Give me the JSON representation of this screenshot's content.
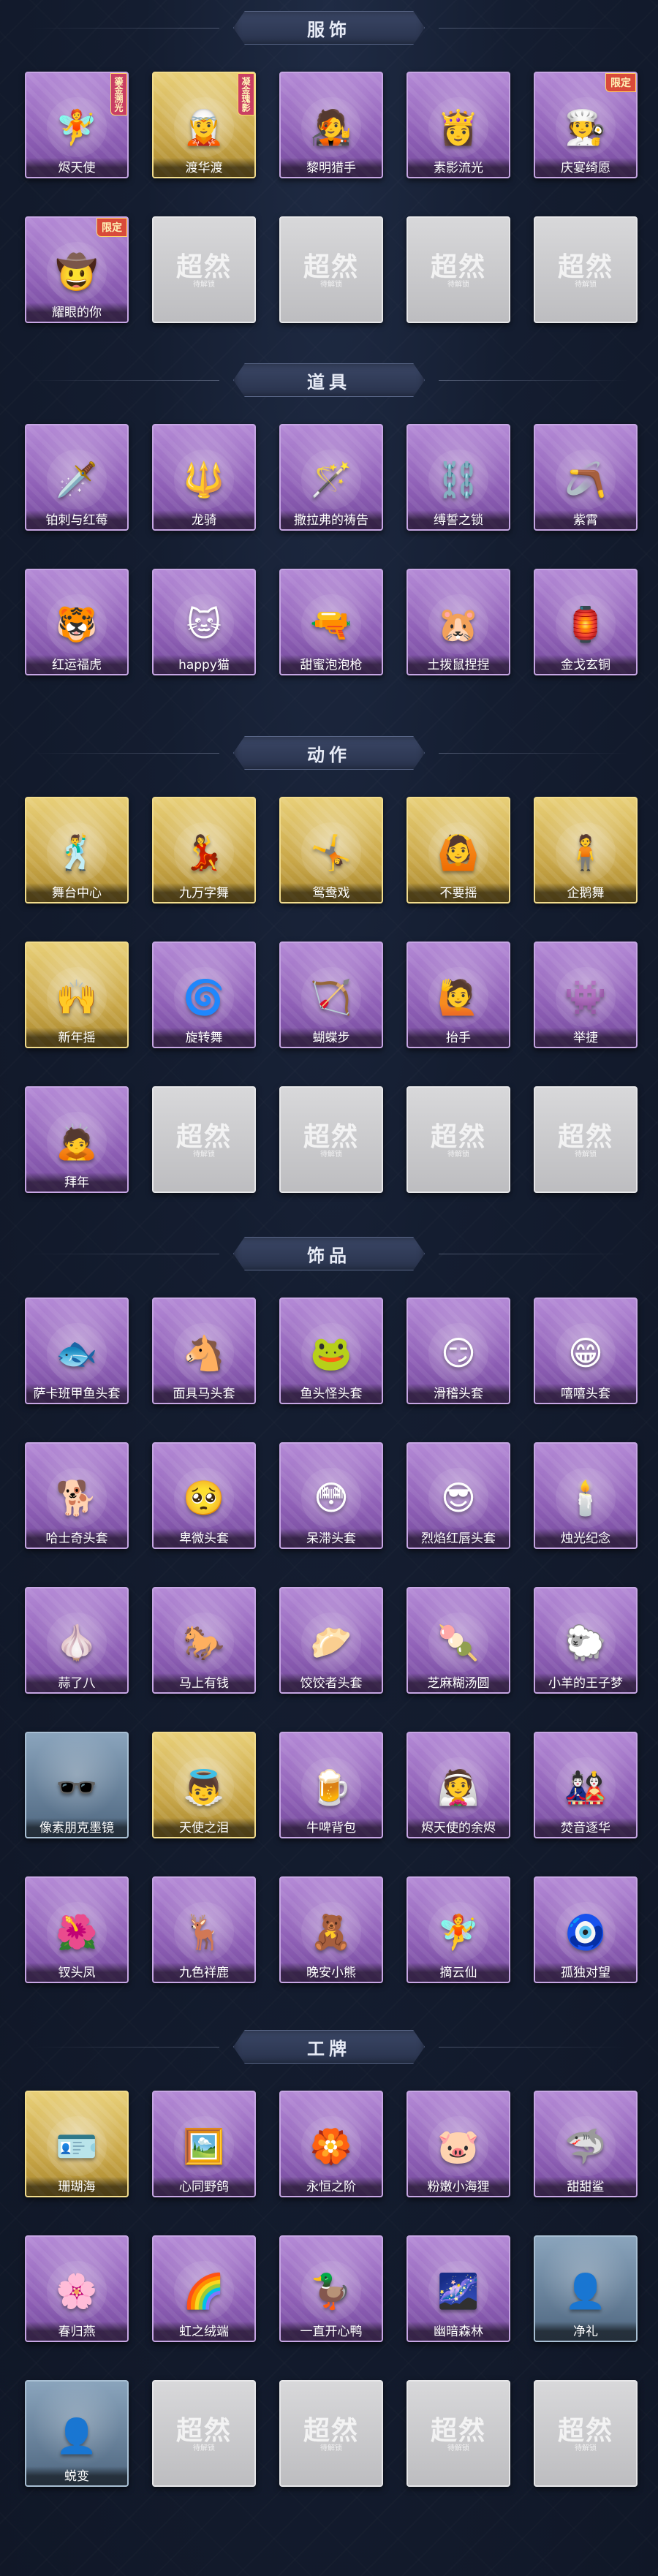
{
  "sections": [
    {
      "title": "服饰",
      "items": [
        {
          "name": "烬天使",
          "rarity": "purple",
          "icon": "🧚",
          "badge": "鎏金溯光"
        },
        {
          "name": "渡华渡",
          "rarity": "gold",
          "icon": "🧝",
          "badge": "凝金瑰影"
        },
        {
          "name": "黎明猎手",
          "rarity": "purple",
          "icon": "🧑‍🎤",
          "badge": ""
        },
        {
          "name": "素影流光",
          "rarity": "purple",
          "icon": "👸",
          "badge": ""
        },
        {
          "name": "庆宴绮愿",
          "rarity": "purple",
          "icon": "🧑‍🍳",
          "badge": "限定"
        },
        {
          "name": "耀眼的你",
          "rarity": "purple",
          "icon": "🤠",
          "badge": "限定"
        },
        {
          "name": "",
          "rarity": "grey",
          "icon": "",
          "badge": ""
        },
        {
          "name": "",
          "rarity": "grey",
          "icon": "",
          "badge": ""
        },
        {
          "name": "",
          "rarity": "grey",
          "icon": "",
          "badge": ""
        },
        {
          "name": "",
          "rarity": "grey",
          "icon": "",
          "badge": ""
        }
      ]
    },
    {
      "title": "道具",
      "items": [
        {
          "name": "铂刺与红莓",
          "rarity": "purple",
          "icon": "🗡️",
          "badge": ""
        },
        {
          "name": "龙骑",
          "rarity": "purple",
          "icon": "🔱",
          "badge": ""
        },
        {
          "name": "撒拉弗的祷告",
          "rarity": "purple",
          "icon": "🪄",
          "badge": ""
        },
        {
          "name": "缚誓之锁",
          "rarity": "purple",
          "icon": "⛓️",
          "badge": ""
        },
        {
          "name": "紫霄",
          "rarity": "purple",
          "icon": "🪃",
          "badge": ""
        },
        {
          "name": "红运福虎",
          "rarity": "purple",
          "icon": "🐯",
          "badge": ""
        },
        {
          "name": "happy猫",
          "rarity": "purple",
          "icon": "🐱",
          "badge": ""
        },
        {
          "name": "甜蜜泡泡枪",
          "rarity": "purple",
          "icon": "🔫",
          "badge": ""
        },
        {
          "name": "土拨鼠捏捏",
          "rarity": "purple",
          "icon": "🐹",
          "badge": ""
        },
        {
          "name": "金戈玄铜",
          "rarity": "purple",
          "icon": "🏮",
          "badge": ""
        }
      ]
    },
    {
      "title": "动作",
      "items": [
        {
          "name": "舞台中心",
          "rarity": "gold",
          "icon": "🕺",
          "badge": ""
        },
        {
          "name": "九万字舞",
          "rarity": "gold",
          "icon": "💃",
          "badge": ""
        },
        {
          "name": "鸳鸯戏",
          "rarity": "gold",
          "icon": "🤸",
          "badge": ""
        },
        {
          "name": "不要摇",
          "rarity": "gold",
          "icon": "🙆",
          "badge": ""
        },
        {
          "name": "企鹅舞",
          "rarity": "gold",
          "icon": "🧍",
          "badge": ""
        },
        {
          "name": "新年摇",
          "rarity": "gold",
          "icon": "🙌",
          "badge": ""
        },
        {
          "name": "旋转舞",
          "rarity": "purple",
          "icon": "🌀",
          "badge": ""
        },
        {
          "name": "蝴蝶步",
          "rarity": "purple",
          "icon": "🏹",
          "badge": ""
        },
        {
          "name": "抬手",
          "rarity": "purple",
          "icon": "🙋",
          "badge": ""
        },
        {
          "name": "举捷",
          "rarity": "purple",
          "icon": "👾",
          "badge": ""
        },
        {
          "name": "拜年",
          "rarity": "purple",
          "icon": "🙇",
          "badge": ""
        },
        {
          "name": "",
          "rarity": "grey",
          "icon": "",
          "badge": ""
        },
        {
          "name": "",
          "rarity": "grey",
          "icon": "",
          "badge": ""
        },
        {
          "name": "",
          "rarity": "grey",
          "icon": "",
          "badge": ""
        },
        {
          "name": "",
          "rarity": "grey",
          "icon": "",
          "badge": ""
        }
      ]
    },
    {
      "title": "饰品",
      "items": [
        {
          "name": "萨卡班甲鱼头套",
          "rarity": "purple",
          "icon": "🐟",
          "badge": ""
        },
        {
          "name": "面具马头套",
          "rarity": "purple",
          "icon": "🐴",
          "badge": ""
        },
        {
          "name": "鱼头怪头套",
          "rarity": "purple",
          "icon": "🐸",
          "badge": ""
        },
        {
          "name": "滑稽头套",
          "rarity": "purple",
          "icon": "😏",
          "badge": ""
        },
        {
          "name": "嘻嘻头套",
          "rarity": "purple",
          "icon": "😁",
          "badge": ""
        },
        {
          "name": "哈士奇头套",
          "rarity": "purple",
          "icon": "🐕",
          "badge": ""
        },
        {
          "name": "卑微头套",
          "rarity": "purple",
          "icon": "🥺",
          "badge": ""
        },
        {
          "name": "呆滞头套",
          "rarity": "purple",
          "icon": "😳",
          "badge": ""
        },
        {
          "name": "烈焰红唇头套",
          "rarity": "purple",
          "icon": "😎",
          "badge": ""
        },
        {
          "name": "烛光纪念",
          "rarity": "purple",
          "icon": "🕯️",
          "badge": ""
        },
        {
          "name": "蒜了八",
          "rarity": "purple",
          "icon": "🧄",
          "badge": ""
        },
        {
          "name": "马上有钱",
          "rarity": "purple",
          "icon": "🐎",
          "badge": ""
        },
        {
          "name": "饺饺者头套",
          "rarity": "purple",
          "icon": "🥟",
          "badge": ""
        },
        {
          "name": "芝麻糊汤圆",
          "rarity": "purple",
          "icon": "🍡",
          "badge": ""
        },
        {
          "name": "小羊的王子梦",
          "rarity": "purple",
          "icon": "🐑",
          "badge": ""
        },
        {
          "name": "像素朋克墨镜",
          "rarity": "blue",
          "icon": "🕶️",
          "badge": ""
        },
        {
          "name": "天使之泪",
          "rarity": "gold",
          "icon": "👼",
          "badge": ""
        },
        {
          "name": "牛啤背包",
          "rarity": "purple",
          "icon": "🍺",
          "badge": ""
        },
        {
          "name": "烬天使的余烬",
          "rarity": "purple",
          "icon": "👰",
          "badge": ""
        },
        {
          "name": "焚音逐华",
          "rarity": "purple",
          "icon": "🎎",
          "badge": ""
        },
        {
          "name": "钗头凤",
          "rarity": "purple",
          "icon": "🌺",
          "badge": ""
        },
        {
          "name": "九色祥鹿",
          "rarity": "purple",
          "icon": "🦌",
          "badge": ""
        },
        {
          "name": "晚安小熊",
          "rarity": "purple",
          "icon": "🧸",
          "badge": ""
        },
        {
          "name": "摘云仙",
          "rarity": "purple",
          "icon": "🧚",
          "badge": ""
        },
        {
          "name": "孤独对望",
          "rarity": "purple",
          "icon": "🧿",
          "badge": ""
        }
      ]
    },
    {
      "title": "工牌",
      "items": [
        {
          "name": "珊瑚海",
          "rarity": "gold",
          "icon": "🪪",
          "badge": ""
        },
        {
          "name": "心同野鸽",
          "rarity": "purple",
          "icon": "🖼️",
          "badge": ""
        },
        {
          "name": "永恒之阶",
          "rarity": "purple",
          "icon": "🏵️",
          "badge": ""
        },
        {
          "name": "粉嫩小海狸",
          "rarity": "purple",
          "icon": "🐷",
          "badge": ""
        },
        {
          "name": "甜甜鲨",
          "rarity": "purple",
          "icon": "🦈",
          "badge": ""
        },
        {
          "name": "春归燕",
          "rarity": "purple",
          "icon": "🌸",
          "badge": ""
        },
        {
          "name": "虹之绒端",
          "rarity": "purple",
          "icon": "🌈",
          "badge": ""
        },
        {
          "name": "一直开心鸭",
          "rarity": "purple",
          "icon": "🦆",
          "badge": ""
        },
        {
          "name": "幽暗森林",
          "rarity": "purple",
          "icon": "🌌",
          "badge": ""
        },
        {
          "name": "净礼",
          "rarity": "blue",
          "icon": "👤",
          "badge": ""
        },
        {
          "name": "蜕变",
          "rarity": "blue",
          "icon": "👤",
          "badge": ""
        },
        {
          "name": "",
          "rarity": "grey",
          "icon": "",
          "badge": ""
        },
        {
          "name": "",
          "rarity": "grey",
          "icon": "",
          "badge": ""
        },
        {
          "name": "",
          "rarity": "grey",
          "icon": "",
          "badge": ""
        },
        {
          "name": "",
          "rarity": "grey",
          "icon": "",
          "badge": ""
        }
      ]
    }
  ],
  "placeholder": {
    "watermark": "超然",
    "watermark_sub": "待解锁"
  }
}
